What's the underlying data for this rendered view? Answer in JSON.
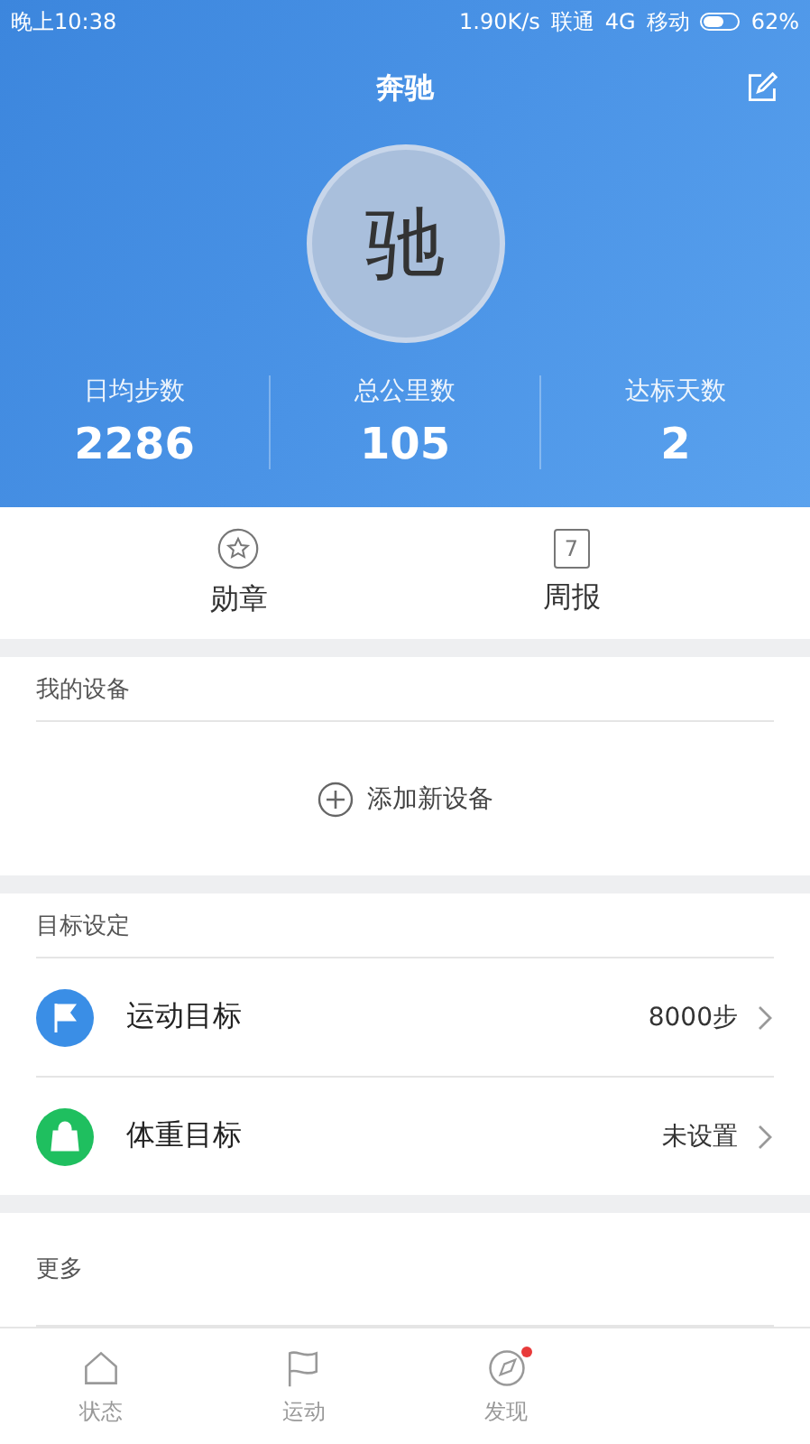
{
  "status_bar": {
    "time": "晚上10:38",
    "speed": "1.90K/s",
    "carrier_1": "联通",
    "network": "4G",
    "carrier_2": "移动",
    "battery": "62%"
  },
  "header": {
    "title": "奔驰",
    "avatar": "驰"
  },
  "stats": [
    {
      "label": "日均步数",
      "value": "2286"
    },
    {
      "label": "总公里数",
      "value": "105"
    },
    {
      "label": "达标天数",
      "value": "2"
    }
  ],
  "shortcuts": [
    {
      "kind": "medal",
      "label": "勋章"
    },
    {
      "kind": "calendar",
      "label": "周报",
      "icon_text": "7"
    }
  ],
  "devices": {
    "title": "我的设备",
    "add_label": "添加新设备"
  },
  "goals": {
    "title": "目标设定",
    "items": [
      {
        "kind": "flag",
        "label": "运动目标",
        "value": "8000步",
        "color": "#3a8ee6"
      },
      {
        "kind": "bag",
        "label": "体重目标",
        "value": "未设置",
        "color": "#1fbf5f"
      }
    ]
  },
  "more": {
    "title": "更多"
  },
  "tabs": [
    {
      "kind": "home",
      "label": "状态",
      "selected": false
    },
    {
      "kind": "flag",
      "label": "运动",
      "selected": false
    },
    {
      "kind": "compass",
      "label": "发现",
      "selected": false,
      "badge": true
    }
  ]
}
